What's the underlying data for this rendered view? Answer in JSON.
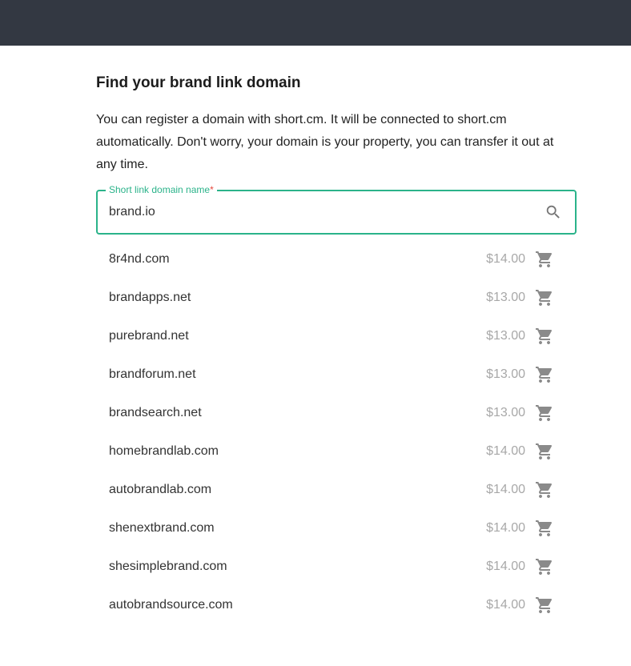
{
  "header": {},
  "page": {
    "title": "Find your brand link domain",
    "description": "You can register a domain with short.cm. It will be connected to short.cm automatically. Don't worry, your domain is your property, you can transfer it out at any time."
  },
  "search": {
    "label": "Short link domain name",
    "required_mark": "*",
    "value": "brand.io",
    "icon": "search-icon"
  },
  "results": [
    {
      "domain": "8r4nd.com",
      "price": "$14.00",
      "icon": "cart-icon"
    },
    {
      "domain": "brandapps.net",
      "price": "$13.00",
      "icon": "cart-icon"
    },
    {
      "domain": "purebrand.net",
      "price": "$13.00",
      "icon": "cart-icon"
    },
    {
      "domain": "brandforum.net",
      "price": "$13.00",
      "icon": "cart-icon"
    },
    {
      "domain": "brandsearch.net",
      "price": "$13.00",
      "icon": "cart-icon"
    },
    {
      "domain": "homebrandlab.com",
      "price": "$14.00",
      "icon": "cart-icon"
    },
    {
      "domain": "autobrandlab.com",
      "price": "$14.00",
      "icon": "cart-icon"
    },
    {
      "domain": "shenextbrand.com",
      "price": "$14.00",
      "icon": "cart-icon"
    },
    {
      "domain": "shesimplebrand.com",
      "price": "$14.00",
      "icon": "cart-icon"
    },
    {
      "domain": "autobrandsource.com",
      "price": "$14.00",
      "icon": "cart-icon"
    }
  ],
  "colors": {
    "header_bg": "#333842",
    "accent": "#2bb38a",
    "required": "#e5483c",
    "price": "#a8a8a8",
    "icon": "#8a8a8a"
  }
}
